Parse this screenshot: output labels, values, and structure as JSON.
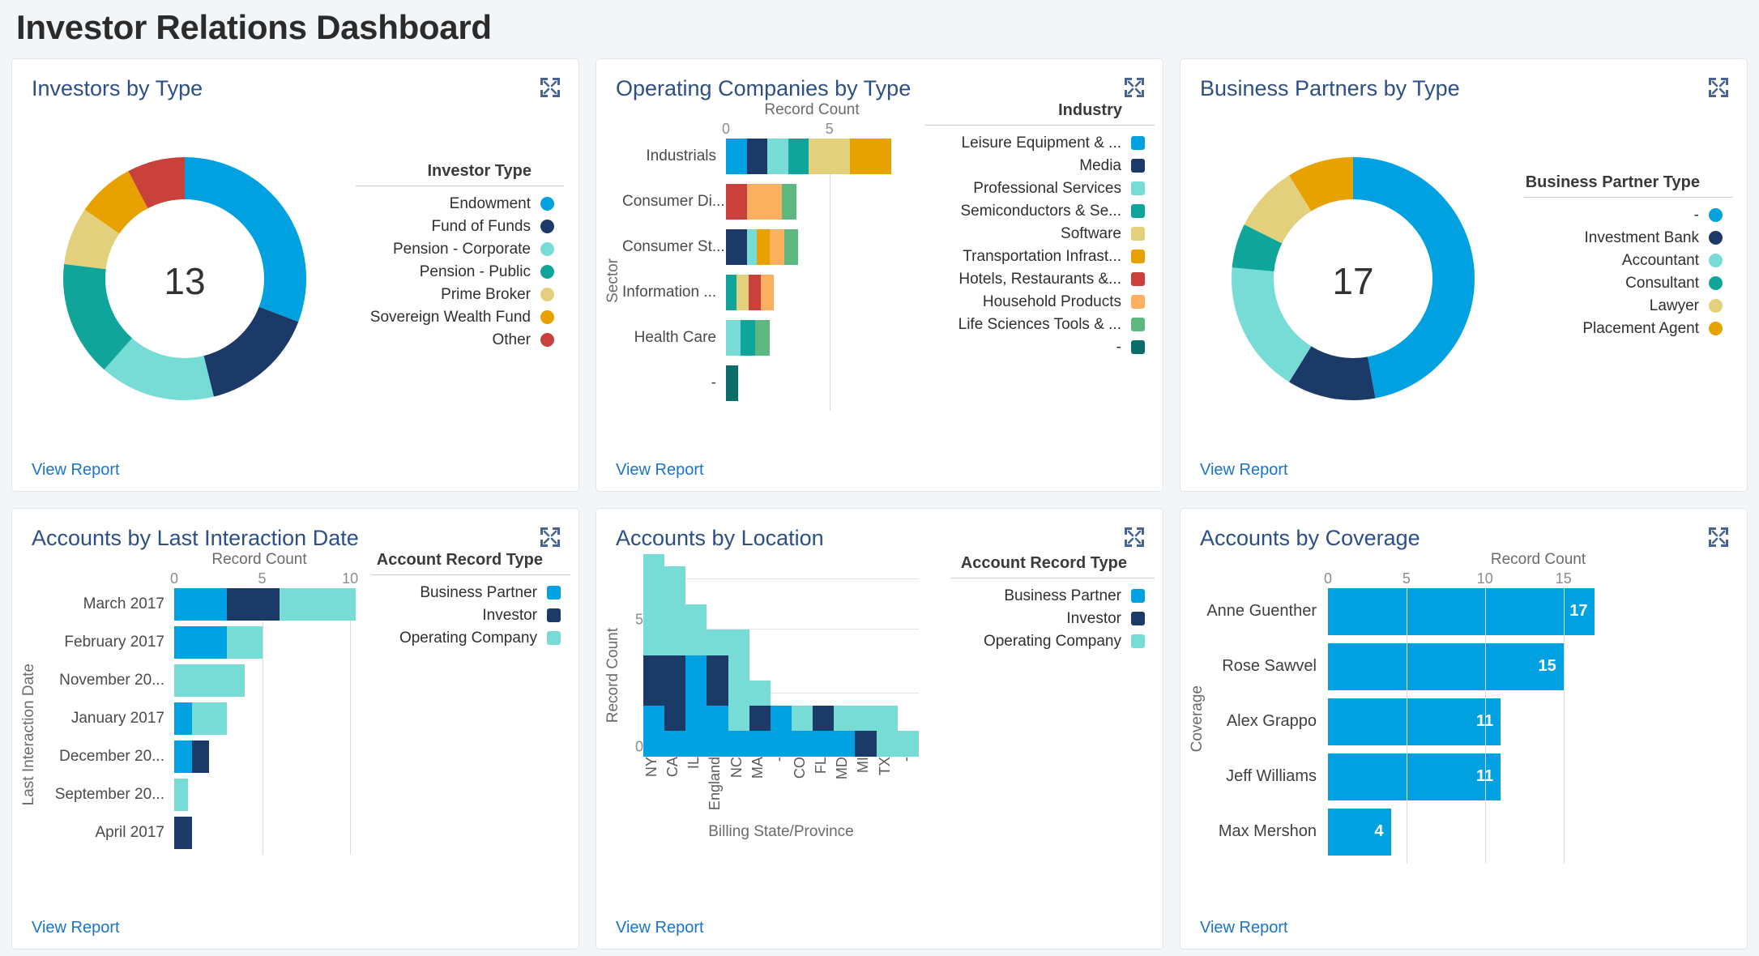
{
  "title": "Investor Relations Dashboard",
  "common": {
    "view_report": "View Report",
    "expand_icon": "expand-icon",
    "record_count": "Record Count"
  },
  "colors": {
    "blue": "#00a1e0",
    "navy": "#1b3a68",
    "mint": "#78dcd6",
    "teal": "#0fa59a",
    "sand": "#e3d07c",
    "amber": "#e8a200",
    "red": "#c9413a",
    "orange": "#fbb060",
    "green": "#5cb87f",
    "darkteal": "#0c6e6a",
    "link": "#1b74c4",
    "title": "#2b4f86"
  },
  "panels": {
    "investors_by_type": {
      "title": "Investors by Type",
      "center_value": "13",
      "legend_title": "Investor Type"
    },
    "operating_companies": {
      "title": "Operating Companies by Type",
      "legend_title": "Industry",
      "axis_title": "Record Count",
      "y_axis_title": "Sector"
    },
    "business_partners": {
      "title": "Business Partners by Type",
      "center_value": "17",
      "legend_title": "Business Partner Type"
    },
    "last_interaction": {
      "title": "Accounts by Last Interaction Date",
      "legend_title": "Account Record Type",
      "axis_title": "Record Count",
      "y_axis_title": "Last Interaction Date"
    },
    "accounts_by_location": {
      "title": "Accounts by Location",
      "legend_title": "Account Record Type",
      "y_axis_title": "Record Count",
      "x_axis_title": "Billing State/Province"
    },
    "accounts_by_coverage": {
      "title": "Accounts by Coverage",
      "axis_title": "Record Count",
      "y_axis_title": "Coverage"
    }
  },
  "chart_data": [
    {
      "id": "investors_by_type",
      "type": "pie",
      "title": "Investors by Type",
      "center_label": "13",
      "legend_title": "Investor Type",
      "legend_position": "right",
      "total": 13,
      "slices": [
        {
          "label": "Endowment",
          "value": 4,
          "color": "#00a1e0"
        },
        {
          "label": "Fund of Funds",
          "value": 2,
          "color": "#1b3a68"
        },
        {
          "label": "Pension - Corporate",
          "value": 2,
          "color": "#78dcd6"
        },
        {
          "label": "Pension - Public",
          "value": 2,
          "color": "#0fa59a"
        },
        {
          "label": "Prime Broker",
          "value": 1,
          "color": "#e3d07c"
        },
        {
          "label": "Sovereign Wealth Fund",
          "value": 1,
          "color": "#e8a200"
        },
        {
          "label": "Other",
          "value": 1,
          "color": "#c9413a"
        }
      ]
    },
    {
      "id": "operating_companies",
      "type": "bar",
      "orientation": "horizontal",
      "stacked": true,
      "title": "Operating Companies by Type",
      "xlabel": "Record Count",
      "ylabel": "Sector",
      "xlim": [
        0,
        9
      ],
      "xticks": [
        0,
        5
      ],
      "legend_title": "Industry",
      "legend_position": "right",
      "categories": [
        "Industrials",
        "Consumer Di...",
        "Consumer St...",
        "Information ...",
        "Health Care",
        "-"
      ],
      "series": [
        {
          "name": "Leisure Equipment & ...",
          "color": "#00a1e0",
          "values": [
            1,
            0,
            0,
            0,
            0,
            0
          ]
        },
        {
          "name": "Media",
          "color": "#1b3a68",
          "values": [
            1,
            0,
            1,
            0,
            0,
            0
          ]
        },
        {
          "name": "Professional Services",
          "color": "#78dcd6",
          "values": [
            1,
            0,
            0.5,
            0,
            0.7,
            0
          ]
        },
        {
          "name": "Semiconductors & Se...",
          "color": "#0fa59a",
          "values": [
            1,
            0,
            0,
            0.5,
            0.7,
            0
          ]
        },
        {
          "name": "Software",
          "color": "#e3d07c",
          "values": [
            2,
            0,
            0,
            0.6,
            0,
            0
          ]
        },
        {
          "name": "Transportation Infrast...",
          "color": "#e8a200",
          "values": [
            2,
            0,
            0.6,
            0,
            0,
            0
          ]
        },
        {
          "name": "Hotels, Restaurants &...",
          "color": "#c9413a",
          "values": [
            0,
            1,
            0,
            0.6,
            0,
            0
          ]
        },
        {
          "name": "Household Products",
          "color": "#fbb060",
          "values": [
            0,
            1.7,
            0.7,
            0.6,
            0,
            0
          ]
        },
        {
          "name": "Life Sciences Tools & ...",
          "color": "#5cb87f",
          "values": [
            0,
            0.7,
            0.7,
            0,
            0.7,
            0
          ]
        },
        {
          "name": "-",
          "color": "#0c6e6a",
          "values": [
            0,
            0,
            0,
            0,
            0,
            0.6
          ]
        }
      ],
      "bar_totals": [
        8,
        4.4,
        3.5,
        2.3,
        2.1,
        0.6
      ]
    },
    {
      "id": "business_partners",
      "type": "pie",
      "title": "Business Partners by Type",
      "center_label": "17",
      "legend_title": "Business Partner Type",
      "legend_position": "right",
      "total": 17,
      "slices": [
        {
          "label": "-",
          "value": 8,
          "color": "#00a1e0"
        },
        {
          "label": "Investment Bank",
          "value": 2,
          "color": "#1b3a68"
        },
        {
          "label": "Accountant",
          "value": 3,
          "color": "#78dcd6"
        },
        {
          "label": "Consultant",
          "value": 1,
          "color": "#0fa59a"
        },
        {
          "label": "Lawyer",
          "value": 1.5,
          "color": "#e3d07c"
        },
        {
          "label": "Placement Agent",
          "value": 1.5,
          "color": "#e8a200"
        }
      ]
    },
    {
      "id": "last_interaction",
      "type": "bar",
      "orientation": "horizontal",
      "stacked": true,
      "title": "Accounts by Last Interaction Date",
      "xlabel": "Record Count",
      "ylabel": "Last Interaction Date",
      "xlim": [
        0,
        10.5
      ],
      "xticks": [
        0,
        5,
        10
      ],
      "legend_title": "Account Record Type",
      "legend_position": "right",
      "categories": [
        "March 2017",
        "February 2017",
        "November 20...",
        "January 2017",
        "December 20...",
        "September 20...",
        "April 2017"
      ],
      "series": [
        {
          "name": "Business Partner",
          "color": "#00a1e0",
          "values": [
            3,
            3,
            0,
            1,
            1,
            0,
            0
          ]
        },
        {
          "name": "Investor",
          "color": "#1b3a68",
          "values": [
            3,
            0,
            0,
            0,
            1,
            0,
            1
          ]
        },
        {
          "name": "Operating Company",
          "color": "#78dcd6",
          "values": [
            4.3,
            2,
            4,
            2,
            0,
            0.8,
            0
          ]
        }
      ],
      "bar_totals": [
        10.3,
        5,
        4,
        3,
        2,
        0.8,
        1
      ]
    },
    {
      "id": "accounts_by_location",
      "type": "bar",
      "orientation": "vertical",
      "stacked": true,
      "title": "Accounts by Location",
      "xlabel": "Billing State/Province",
      "ylabel": "Record Count",
      "ylim": [
        0,
        8
      ],
      "yticks": [
        0,
        5
      ],
      "legend_title": "Account Record Type",
      "legend_position": "right",
      "categories": [
        "NY",
        "CA",
        "IL",
        "England",
        "NC",
        "MA",
        "-",
        "CO",
        "FL",
        "MD",
        "MI",
        "TX",
        "-"
      ],
      "series": [
        {
          "name": "Business Partner",
          "color": "#00a1e0",
          "values": [
            2,
            1,
            4,
            2,
            1,
            1,
            2,
            1,
            1,
            1,
            0,
            0,
            0
          ]
        },
        {
          "name": "Investor",
          "color": "#1b3a68",
          "values": [
            2,
            3,
            0,
            2,
            0,
            1,
            0,
            0,
            1,
            0,
            1,
            0,
            0
          ]
        },
        {
          "name": "Operating Company",
          "color": "#78dcd6",
          "values": [
            4,
            3.5,
            2,
            1,
            4,
            1,
            0,
            1,
            0,
            1,
            1,
            2,
            1
          ]
        }
      ],
      "bar_totals": [
        8,
        7.5,
        6,
        5,
        5,
        3,
        2,
        2,
        2,
        2,
        2,
        2,
        1
      ]
    },
    {
      "id": "accounts_by_coverage",
      "type": "bar",
      "orientation": "horizontal",
      "stacked": false,
      "title": "Accounts by Coverage",
      "xlabel": "Record Count",
      "ylabel": "Coverage",
      "xlim": [
        0,
        17.8
      ],
      "xticks": [
        0,
        5,
        10,
        15
      ],
      "color": "#00a1e0",
      "categories": [
        "Anne Guenther",
        "Rose Sawvel",
        "Alex Grappo",
        "Jeff Williams",
        "Max Mershon"
      ],
      "values": [
        17,
        15,
        11,
        11,
        4
      ],
      "value_labels": [
        "17",
        "15",
        "11",
        "11",
        "4"
      ]
    }
  ]
}
